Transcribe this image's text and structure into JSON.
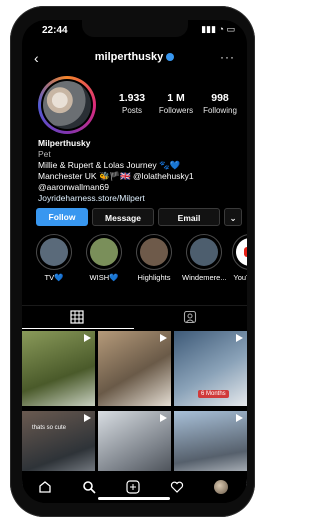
{
  "status": {
    "time": "22:44",
    "icons": "▮▮▮ ◔ ▭"
  },
  "header": {
    "username": "milperthusky",
    "back": "‹",
    "more": "···"
  },
  "profile": {
    "stats": [
      {
        "value": "1.933",
        "label": "Posts"
      },
      {
        "value": "1 M",
        "label": "Followers"
      },
      {
        "value": "998",
        "label": "Following"
      }
    ],
    "name": "Milperthusky",
    "category": "Pet",
    "bio_line1": "Millie & Rupert & Lolas Journey 🐾💙",
    "bio_line2": "Manchester UK 🐝🏴🇬🇧 @lolathehusky1",
    "bio_line3": "@aaronwallman69",
    "link": "Joyrideharness.store/Milpert"
  },
  "actions": {
    "follow": "Follow",
    "message": "Message",
    "email": "Email",
    "dropdown": "⌄"
  },
  "highlights": [
    {
      "label": "TV💙",
      "color": "#5a6a7a"
    },
    {
      "label": "WISH💙",
      "color": "#7a8f5a"
    },
    {
      "label": "Highlights",
      "color": "#6e5a4a"
    },
    {
      "label": "Windemere...",
      "color": "#4d5e6e"
    },
    {
      "label": "YouT",
      "color": "#e62117"
    }
  ],
  "grid": {
    "badge": "6 Months",
    "overlay": "thats so cute",
    "cells": [
      "#6c7d3a",
      "#7a6a55",
      "#4e5f70",
      "#5a5f66",
      "#9a9fa6",
      "#8fa3b5"
    ]
  },
  "colors": {
    "accent": "#3897f0",
    "background": "#000000"
  }
}
